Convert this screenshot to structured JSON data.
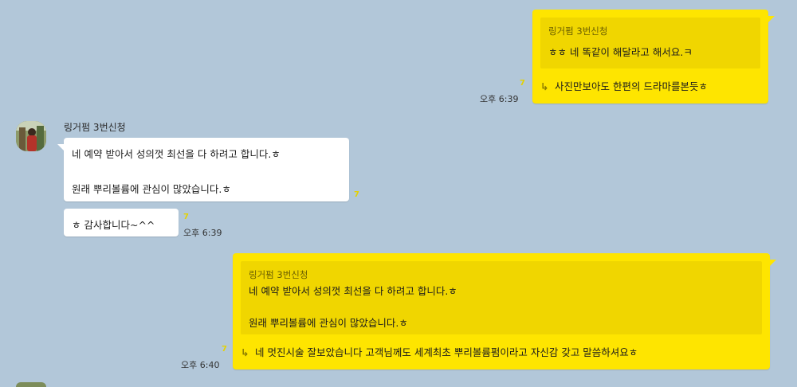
{
  "messages": [
    {
      "type": "outgoing_reply",
      "quote_author": "링거펌 3번신청",
      "quote_text": "ㅎㅎ 네 똑같이 해달라고 해서요.ㅋ",
      "reply_text": "사진만보아도 한편의 드라마를본듯ㅎ",
      "unread": "7",
      "time": "오후 6:39"
    },
    {
      "type": "incoming",
      "sender": "링거펌 3번신청",
      "bubble1_line1": "네 예약 받아서 성의껏 최선을 다 하려고 합니다.ㅎ",
      "bubble1_line2": "원래 뿌리볼륨에 관심이 많았습니다.ㅎ",
      "bubble1_unread": "7",
      "bubble2_text": "ㅎ 감사합니다~^^",
      "bubble2_unread": "7",
      "time": "오후 6:39"
    },
    {
      "type": "outgoing_reply",
      "quote_author": "링거펌 3번신청",
      "quote_line1": "네 예약 받아서 성의껏 최선을 다 하려고 합니다.ㅎ",
      "quote_line2": "원래 뿌리볼륨에 관심이 많았습니다.ㅎ",
      "reply_text": "네 멋진시술 잘보았습니다 고객님께도 세계최초 뿌리볼륨펌이라고 자신감 갖고 말씀하셔요ㅎ",
      "unread": "7",
      "time": "오후 6:40"
    }
  ],
  "icons": {
    "reply_arrow": "reply-arrow-icon",
    "avatar": "profile-avatar"
  },
  "colors": {
    "background": "#b2c7d9",
    "outgoing_bubble": "#fee500",
    "quote_box": "#f0d600",
    "incoming_bubble": "#ffffff"
  }
}
